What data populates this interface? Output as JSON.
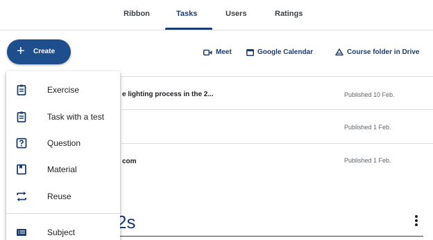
{
  "nav": {
    "tabs": [
      {
        "label": "Ribbon"
      },
      {
        "label": "Tasks"
      },
      {
        "label": "Users"
      },
      {
        "label": "Ratings"
      }
    ]
  },
  "toolbar": {
    "create_label": "Create",
    "links": [
      {
        "label": "Meet",
        "icon": "video-camera-icon"
      },
      {
        "label": "Google Calendar",
        "icon": "calendar-icon"
      },
      {
        "label": "Course folder in Drive",
        "icon": "drive-icon"
      }
    ]
  },
  "stream": {
    "rows": [
      {
        "title": "e lighting process in the 2...",
        "meta": "Published 10 Feb."
      },
      {
        "title": "",
        "meta": "Published 1 Feb."
      },
      {
        "title": "com",
        "meta": "Published 1 Feb."
      }
    ],
    "section_heading": "2s"
  },
  "create_menu": {
    "items": [
      {
        "label": "Exercise",
        "icon": "assignment-icon"
      },
      {
        "label": "Task with a test",
        "icon": "assignment-quiz-icon"
      },
      {
        "label": "Question",
        "icon": "question-icon"
      },
      {
        "label": "Material",
        "icon": "material-icon"
      },
      {
        "label": "Reuse",
        "icon": "repeat-icon"
      },
      {
        "label": "Subject",
        "icon": "topic-icon"
      }
    ]
  },
  "colors": {
    "accent": "#1a3c6e",
    "button": "#1f4e8c"
  }
}
